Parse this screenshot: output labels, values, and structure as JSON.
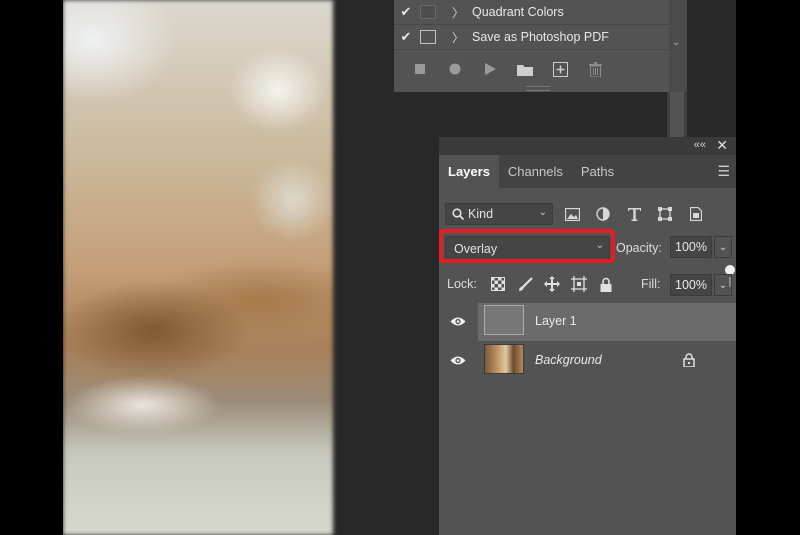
{
  "actions_panel": {
    "items": [
      {
        "checked": true,
        "has_dialog": false,
        "name": "Quadrant Colors"
      },
      {
        "checked": true,
        "has_dialog": true,
        "name": "Save as Photoshop PDF"
      }
    ],
    "toolbar": [
      "stop-icon",
      "record-icon",
      "play-icon",
      "new-set-icon",
      "new-action-icon",
      "delete-icon"
    ]
  },
  "layers_panel": {
    "tabs": [
      {
        "label": "Layers",
        "active": true
      },
      {
        "label": "Channels",
        "active": false
      },
      {
        "label": "Paths",
        "active": false
      }
    ],
    "filter": {
      "label": "Kind"
    },
    "blend_mode": "Overlay",
    "opacity_label": "Opacity:",
    "opacity": "100%",
    "lock_label": "Lock:",
    "fill_label": "Fill:",
    "fill": "100%",
    "layers": [
      {
        "name": "Layer 1",
        "visible": true,
        "selected": true,
        "locked": false
      },
      {
        "name": "Background",
        "visible": true,
        "selected": false,
        "locked": true
      }
    ],
    "colors": {
      "highlight": "#e31e24",
      "panel": "#535353",
      "selected_row": "#6b6b6b"
    }
  }
}
